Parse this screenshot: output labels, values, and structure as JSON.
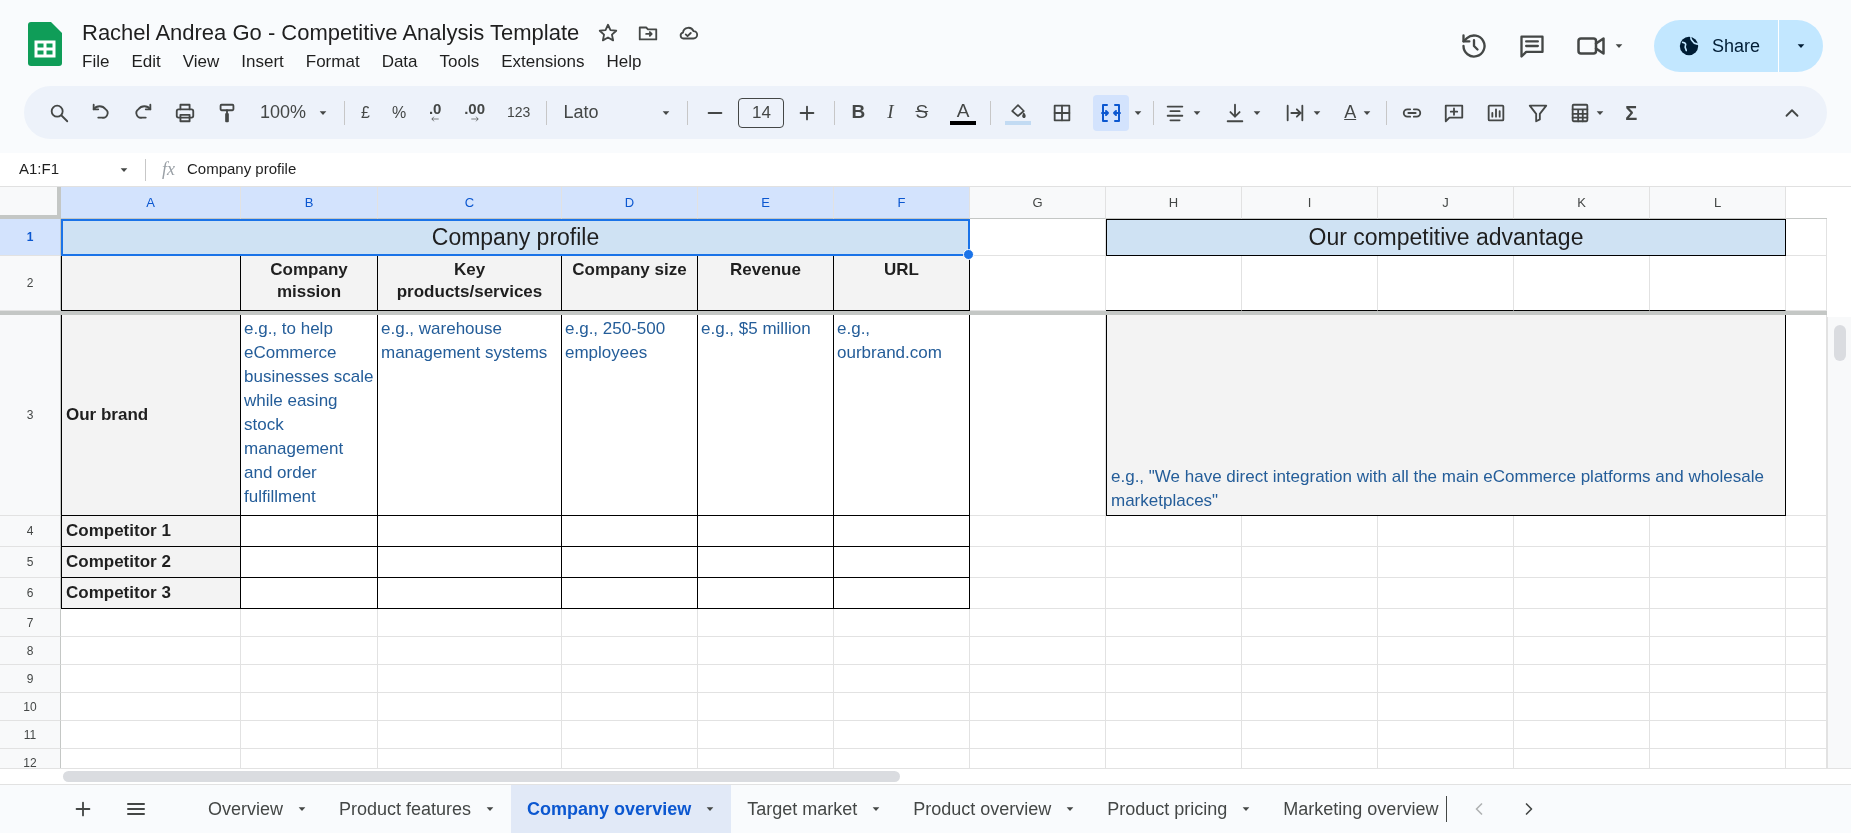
{
  "document": {
    "title": "Rachel Andrea Go - Competitive Analysis Template",
    "menu": [
      "File",
      "Edit",
      "View",
      "Insert",
      "Format",
      "Data",
      "Tools",
      "Extensions",
      "Help"
    ],
    "share": "Share"
  },
  "toolbar": {
    "zoom": "100%",
    "currency": "£",
    "percent": "%",
    "decimals_less": ".0",
    "decimals_more": ".00",
    "number_format": "123",
    "font": "Lato",
    "font_size": "14",
    "bold": "B",
    "italic": "I",
    "strikethrough": "S",
    "text_color": "A",
    "text_rotation": "A",
    "functions": "Σ",
    "merge_on": true
  },
  "formula_bar": {
    "cell_ref": "A1:F1",
    "fx": "fx",
    "formula": "Company profile"
  },
  "columns": [
    {
      "label": "A",
      "selected": true
    },
    {
      "label": "B",
      "selected": true
    },
    {
      "label": "C",
      "selected": true
    },
    {
      "label": "D",
      "selected": true
    },
    {
      "label": "E",
      "selected": true
    },
    {
      "label": "F",
      "selected": true
    },
    {
      "label": "G",
      "selected": false
    },
    {
      "label": "H",
      "selected": false
    },
    {
      "label": "I",
      "selected": false
    },
    {
      "label": "J",
      "selected": false
    },
    {
      "label": "K",
      "selected": false
    },
    {
      "label": "L",
      "selected": false
    }
  ],
  "row_numbers": [
    {
      "label": "1",
      "selected": true
    },
    {
      "label": "2",
      "selected": false
    },
    {
      "label": "3",
      "selected": false
    },
    {
      "label": "4",
      "selected": false
    },
    {
      "label": "5",
      "selected": false
    },
    {
      "label": "6",
      "selected": false
    },
    {
      "label": "7",
      "selected": false
    },
    {
      "label": "8",
      "selected": false
    },
    {
      "label": "9",
      "selected": false
    },
    {
      "label": "10",
      "selected": false
    },
    {
      "label": "11",
      "selected": false
    },
    {
      "label": "12",
      "selected": false
    }
  ],
  "profile_table": {
    "title": {
      "text": "Company profile",
      "selected": true
    },
    "headers": [
      "Company mission",
      "Key products/services",
      "Company size",
      "Revenue",
      "URL"
    ],
    "rows": [
      {
        "label": "Our brand",
        "cells": [
          "e.g., to help eCommerce businesses scale while easing stock management and order fulfillment",
          "e.g., warehouse management systems",
          "e.g., 250-500 employees",
          "e.g., $5 million",
          "e.g., ourbrand.com"
        ]
      },
      {
        "label": "Competitor 1",
        "cells": []
      },
      {
        "label": "Competitor 2",
        "cells": []
      },
      {
        "label": "Competitor 3",
        "cells": []
      }
    ]
  },
  "advantage": {
    "title": "Our competitive advantage",
    "text": "e.g., \"We have direct integration with all the main eCommerce platforms and wholesale marketplaces\""
  },
  "sheet_tabs": [
    {
      "label": "Overview",
      "selected": false,
      "caret": true
    },
    {
      "label": "Product features",
      "selected": false,
      "caret": true
    },
    {
      "label": "Company overview",
      "selected": true,
      "caret": true
    },
    {
      "label": "Target market",
      "selected": false,
      "caret": true
    },
    {
      "label": "Product overview",
      "selected": false,
      "caret": true
    },
    {
      "label": "Product pricing",
      "selected": false,
      "caret": true
    },
    {
      "label": "Marketing overview",
      "selected": false,
      "caret": false
    }
  ]
}
